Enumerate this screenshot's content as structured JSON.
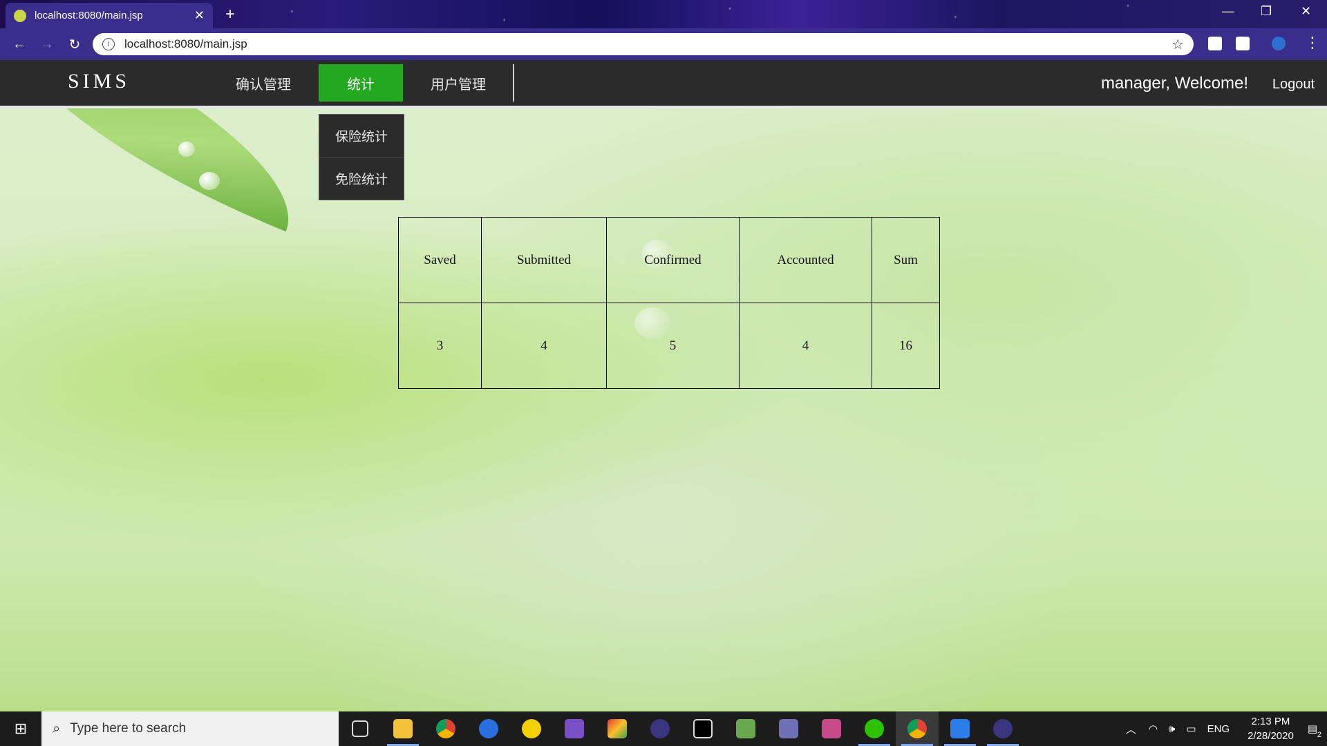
{
  "browser": {
    "tab_title": "localhost:8080/main.jsp",
    "new_tab": "+",
    "url": "localhost:8080/main.jsp",
    "window_controls": [
      "—",
      "❐",
      "✕"
    ]
  },
  "app": {
    "brand": "SIMS",
    "menu": [
      {
        "label": "确认管理",
        "active": false
      },
      {
        "label": "统计",
        "active": true
      },
      {
        "label": "用户管理",
        "active": false
      }
    ],
    "dropdown": [
      "保险统计",
      "免险统计"
    ],
    "welcome": "manager, Welcome!",
    "logout": "Logout",
    "accent_color": "#22a91f"
  },
  "stats_table": {
    "headers": [
      "Saved",
      "Submitted",
      "Confirmed",
      "Accounted",
      "Sum"
    ],
    "values": [
      "3",
      "4",
      "5",
      "4",
      "16"
    ]
  },
  "taskbar": {
    "search_placeholder": "Type here to search",
    "language": "ENG",
    "time": "2:13 PM",
    "date": "2/28/2020",
    "notification_count": "2",
    "apps": [
      "task-view",
      "file-explorer",
      "chrome",
      "sogou",
      "norton",
      "visual-studio",
      "ms-paint",
      "eclipse",
      "intellij",
      "notepad",
      "tortoise",
      "wechat-tools",
      "wechat",
      "chrome-active",
      "wps",
      "eclipse-2"
    ]
  }
}
